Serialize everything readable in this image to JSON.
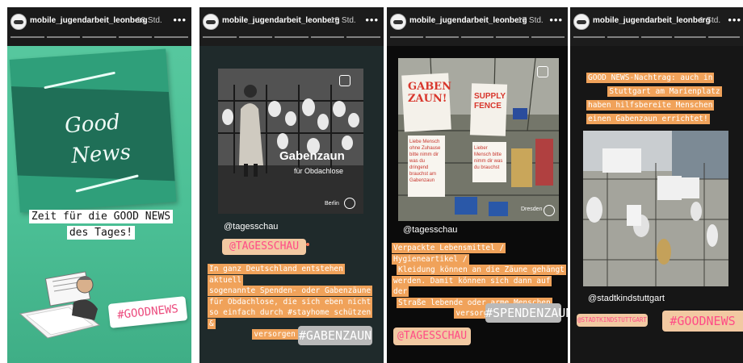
{
  "stories": [
    {
      "account": "mobile_jugendarbeit_leonberg",
      "time": "18 Std.",
      "good_word_1": "Good",
      "good_word_2": "News",
      "caption_line_1": "Zeit für die GOOD NEWS",
      "caption_line_2": "des Tages!",
      "hashtag": "#GOODNEWS"
    },
    {
      "account": "mobile_jugendarbeit_leonberg",
      "time": "18 Std.",
      "photo_title": "Gabenzaun",
      "photo_subtitle": "für Obdachlose",
      "photo_credit": "Berlin",
      "handle": "@tagesschau",
      "mention_tag": "@TAGESSCHAU",
      "text_lines": [
        "In ganz Deutschland entstehen aktuell",
        "sogenannte Spenden- oder Gabenzäune",
        "für Obdachlose, die sich eben nicht",
        "so einfach durch #stayhome schützen &",
        "versorgen können."
      ],
      "hashtag": "#GABENZAUN"
    },
    {
      "account": "mobile_jugendarbeit_leonberg",
      "time": "17 Std.",
      "sign_left": "GABEN ZAUN!",
      "sign_right": "SUPPLY FENCE",
      "note_left": "Liebe Mensch ohne Zuhause bitte nimm dir was du dringend brauchst am Gabenzaun",
      "note_right": "Lieber Mensch bitte nimm dir was du brauchst",
      "photo_credit": "Dresden",
      "handle": "@tagesschau",
      "text_lines": [
        "Verpackte Lebensmittel / Hygieneartikel /",
        "Kleidung können an die Zäune gehängt",
        "werden. Damit können sich dann auf der",
        "Straße lebende oder arme Menschen",
        "versorgen."
      ],
      "hashtag": "#SPENDENZAUN",
      "mention_tag": "@TAGESSCHAU"
    },
    {
      "account": "mobile_jugendarbeit_leonberg",
      "time": "1 Std.",
      "text_lines": [
        "GOOD NEWS-Nachtrag: auch in",
        "Stuttgart am Marienplatz",
        "haben hilfsbereite Menschen",
        "einen Gabenzaun errichtet!"
      ],
      "handle": "@stadtkindstuttgart",
      "mention_tag": "@STADTKINDSTUTTGART",
      "hashtag": "#GOODNEWS"
    }
  ],
  "colors": {
    "story1_bg": "#4bbf95",
    "story2_bg": "#1f2a2b",
    "story3_bg": "#0b0b0b",
    "story4_bg": "#161616",
    "tag_pink": "#ff4c86",
    "tag_peach": "#f2c9a2",
    "text_highlight_orange": "#f0a25a",
    "tag_gray": "#b9b9b9"
  },
  "icons": [
    "account-avatar-icon",
    "more-options-icon",
    "speaker-icon",
    "tagesschau-logo-icon"
  ]
}
